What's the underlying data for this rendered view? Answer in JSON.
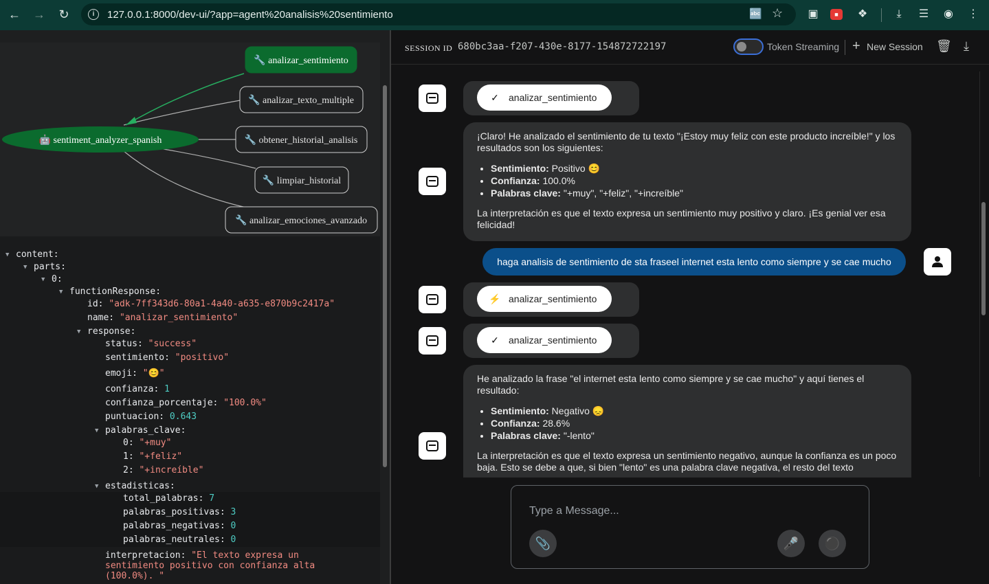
{
  "browser": {
    "url": "127.0.0.1:8000/dev-ui/?app=agent%20analisis%20sentimiento",
    "nav_icons": [
      "back-icon",
      "forward-icon",
      "reload-icon"
    ],
    "toolbar_icons": [
      "translate-icon",
      "star-icon",
      "cast-icon",
      "extension-red-icon",
      "puzzle-icon",
      "download-icon",
      "media-icon",
      "profile-icon",
      "menu-icon"
    ]
  },
  "graph": {
    "root": "🤖 sentiment_analyzer_spanish",
    "nodes": [
      {
        "label": "🔧 analizar_sentimiento",
        "active": true
      },
      {
        "label": "🔧 analizar_texto_multiple",
        "active": false
      },
      {
        "label": "🔧 obtener_historial_analisis",
        "active": false
      },
      {
        "label": "🔧 limpiar_historial",
        "active": false
      },
      {
        "label": "🔧 analizar_emociones_avanzado",
        "active": false
      }
    ]
  },
  "tree": {
    "content": "content:",
    "parts": "parts:",
    "idx0": "0:",
    "functionResponse": "functionResponse:",
    "id_key": "id:",
    "id_val": "\"adk-7ff343d6-80a1-4a40-a635-e870b9c2417a\"",
    "name_key": "name:",
    "name_val": "\"analizar_sentimiento\"",
    "response": "response:",
    "status_key": "status:",
    "status_val": "\"success\"",
    "sent_key": "sentimiento:",
    "sent_val": "\"positivo\"",
    "emoji_key": "emoji:",
    "emoji_val": "\"😊\"",
    "conf_key": "confianza:",
    "conf_val": "1",
    "confp_key": "confianza_porcentaje:",
    "confp_val": "\"100.0%\"",
    "punt_key": "puntuacion:",
    "punt_val": "0.643",
    "pal_key": "palabras_clave:",
    "pal0_key": "0:",
    "pal0_val": "\"+muy\"",
    "pal1_key": "1:",
    "pal1_val": "\"+feliz\"",
    "pal2_key": "2:",
    "pal2_val": "\"+increíble\"",
    "est_key": "estadisticas:",
    "tot_key": "total_palabras:",
    "tot_val": "7",
    "pos_key": "palabras_positivas:",
    "pos_val": "3",
    "neg_key": "palabras_negativas:",
    "neg_val": "0",
    "neu_key": "palabras_neutrales:",
    "neu_val": "0",
    "interp_key": "interpretacion:",
    "interp_l1": "\"El texto expresa un",
    "interp_l2": "sentimiento positivo con confianza alta",
    "interp_l3": "(100.0%). \""
  },
  "session": {
    "label": "SESSION ID",
    "id": "680bc3aa-f207-430e-8177-154872722197",
    "token_streaming": "Token Streaming",
    "new_session": "New Session"
  },
  "chat": {
    "fn1": "analizar_sentimiento",
    "msg1_intro": "¡Claro! He analizado el sentimiento de tu texto \"¡Estoy muy feliz con este producto increíble!\" y los resultados son los siguientes:",
    "msg1_b1_label": "Sentimiento:",
    "msg1_b1_val": " Positivo 😊",
    "msg1_b2_label": "Confianza:",
    "msg1_b2_val": " 100.0%",
    "msg1_b3_label": "Palabras clave:",
    "msg1_b3_val": " \"+muy\", \"+feliz\", \"+increíble\"",
    "msg1_outro": "La interpretación es que el texto expresa un sentimiento muy positivo y claro. ¡Es genial ver esa felicidad!",
    "user_msg": "haga analisis de sentimiento de sta fraseel internet esta lento como siempre y se cae mucho",
    "fn2": "analizar_sentimiento",
    "fn3": "analizar_sentimiento",
    "msg2_intro": "He analizado la frase \"el internet esta lento como siempre y se cae mucho\" y aquí tienes el resultado:",
    "msg2_b1_label": "Sentimiento:",
    "msg2_b1_val": " Negativo 😞",
    "msg2_b2_label": "Confianza:",
    "msg2_b2_val": " 28.6%",
    "msg2_b3_label": "Palabras clave:",
    "msg2_b3_val": " \"-lento\"",
    "msg2_outro": "La interpretación es que el texto expresa un sentimiento negativo, aunque la confianza es un poco baja. Esto se debe a que, si bien \"lento\" es una palabra clave negativa, el resto del texto"
  },
  "composer": {
    "placeholder": "Type a Message..."
  }
}
